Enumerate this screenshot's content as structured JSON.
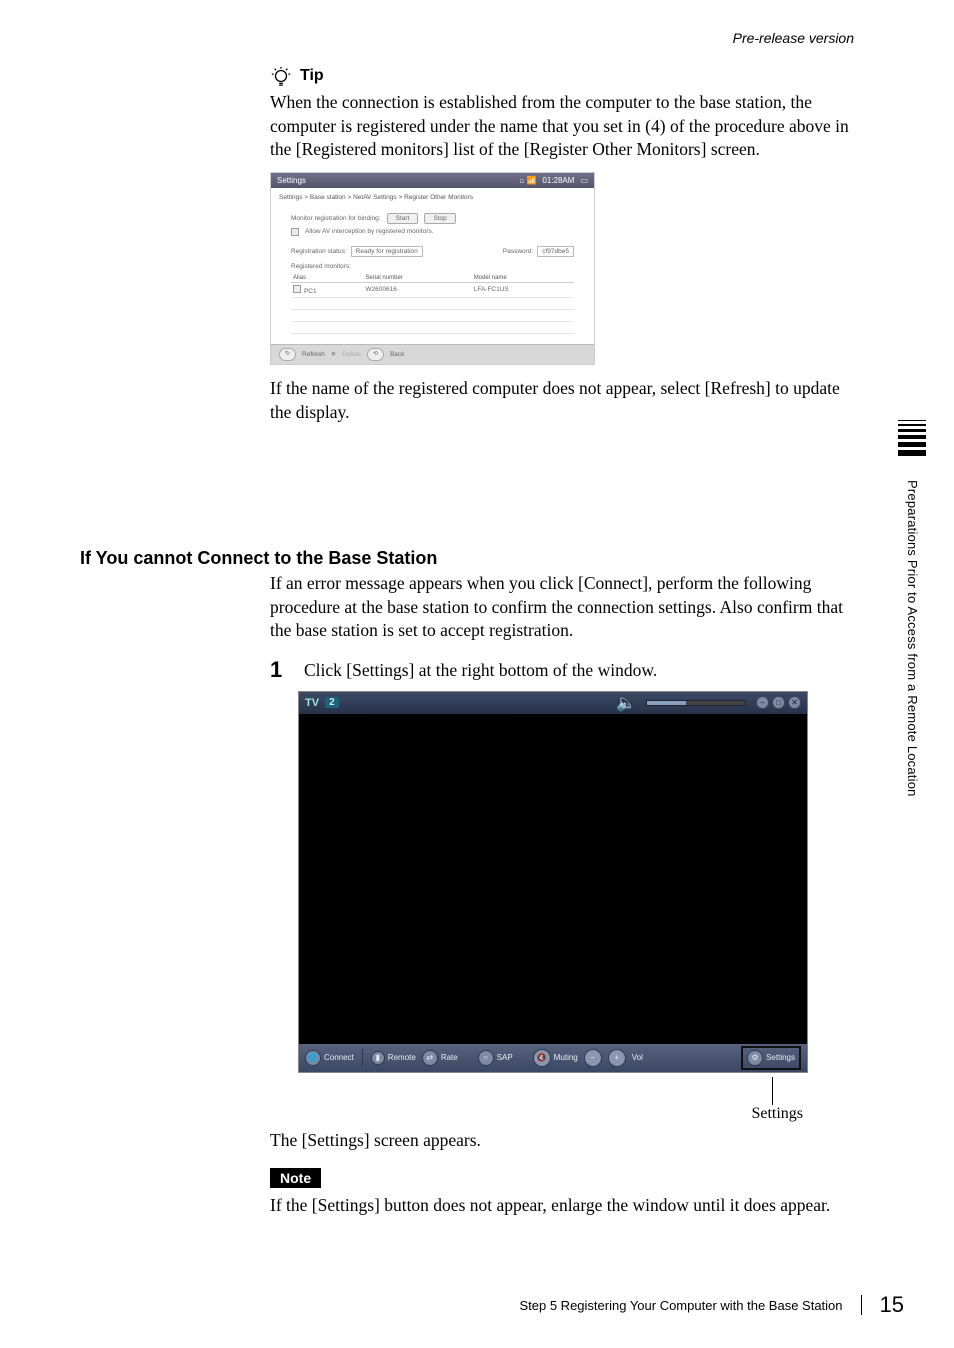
{
  "header": {
    "prerelease": "Pre-release version"
  },
  "tip": {
    "label": "Tip",
    "body": "When the connection is established from the computer to the base station, the computer is registered under the name that you set in (4) of the procedure above in the [Registered monitors] list of the [Register Other Monitors] screen."
  },
  "screenshot1": {
    "title": "Settings",
    "clock": "01:28AM",
    "breadcrumb": "Settings > Base station > NetAV Settings > Register Other Monitors",
    "monitor_reg_label": "Monitor registration for binding:",
    "start": "Start",
    "stop": "Stop",
    "allow_av": "Allow AV interception by registered monitors.",
    "reg_status_label": "Registration status:",
    "reg_status_value": "Ready for registration",
    "password_label": "Password:",
    "password_value": "cf97dbe5",
    "registered_monitors_label": "Registered monitors:",
    "table": {
      "cols": [
        "Alias",
        "Serial number",
        "Model name"
      ],
      "rows": [
        {
          "alias": "PC1",
          "serial": "W2600616",
          "model": "LFA-FC1US"
        }
      ]
    },
    "footer": {
      "refresh": "Refresh",
      "delete": "Delete",
      "back": "Back"
    }
  },
  "after_shot1": "If the name of the registered computer does not appear, select [Refresh] to update the display.",
  "subheading": "If You cannot Connect to the Base Station",
  "sub_intro": "If an error message appears when you click [Connect], perform the following procedure at the base station to confirm the connection settings. Also confirm that the base station is set to accept registration.",
  "step1": {
    "num": "1",
    "text": "Click [Settings] at the right bottom of the window."
  },
  "tv": {
    "title_prefix": "TV",
    "channel": "2",
    "toolbar": {
      "connect": "Connect",
      "remote": "Remote",
      "rate": "Rate",
      "sap": "SAP",
      "muting": "Muting",
      "vol": "Vol",
      "settings": "Settings"
    },
    "callout": "Settings"
  },
  "after_tv": "The [Settings] screen appears.",
  "note": {
    "label": "Note",
    "body": "If the [Settings] button does not appear, enlarge the window until it does appear."
  },
  "side_tab": "Preparations Prior to Access from a Remote Location",
  "footer_page": {
    "step_title": "Step 5 Registering Your Computer with the Base Station",
    "num": "15"
  }
}
